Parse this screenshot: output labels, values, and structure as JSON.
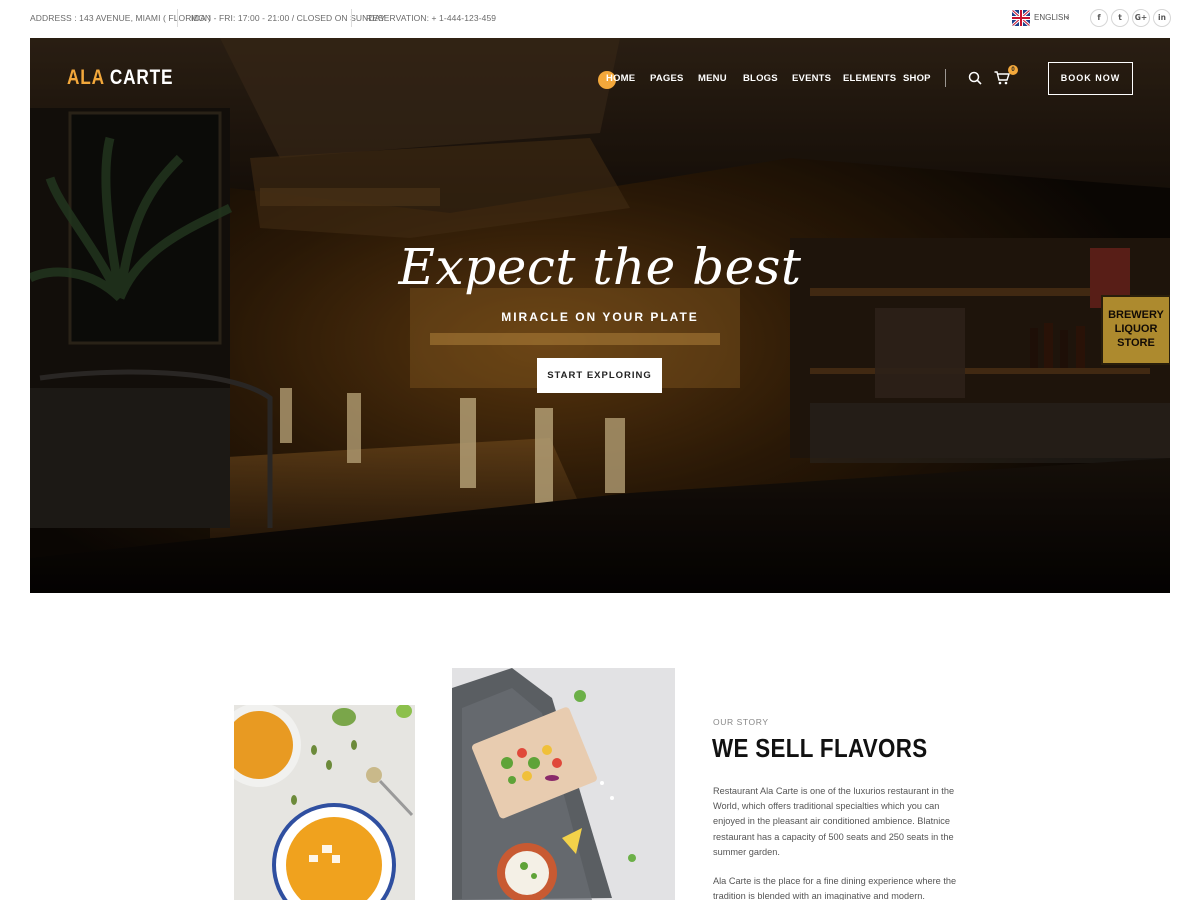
{
  "topbar": {
    "address": "ADDRESS : 143 AVENUE, MIAMI ( FLORIDA )",
    "hours": "MON - FRI: 17:00 - 21:00 / CLOSED ON SUNDAY",
    "reservation": "RESERVATION: + 1-444-123-459",
    "language": "ENGLISH",
    "social": [
      "f",
      "t",
      "G+",
      "in"
    ]
  },
  "header": {
    "logo_first": "ALA",
    "logo_second": "CARTE",
    "nav": [
      "HOME",
      "PAGES",
      "MENU",
      "BLOGS",
      "EVENTS",
      "ELEMENTS",
      "SHOP"
    ],
    "active_nav": "HOME",
    "cart_count": "0",
    "book_label": "BOOK NOW"
  },
  "hero": {
    "headline": "Expect the best",
    "subline": "MIRACLE ON YOUR PLATE",
    "cta_label": "START EXPLORING",
    "sign_text": [
      "BREWERY",
      "LIQUOR",
      "STORE"
    ]
  },
  "story": {
    "kicker": "OUR STORY",
    "title": "WE SELL FLAVORS",
    "paragraph1": "Restaurant Ala Carte is one of the luxurios restaurant in the World, which offers traditional specialties which you can enjoyed in the pleasant air conditioned ambience. Blatnice restaurant has a capacity of 500 seats and 250 seats in the summer garden.",
    "paragraph2": "Ala Carte is the place for a fine dining experience where the tradition is blended with an imaginative and modern."
  },
  "colors": {
    "accent": "#f3a83b",
    "hero_bg": "#120c07",
    "text_dark": "#111111"
  }
}
